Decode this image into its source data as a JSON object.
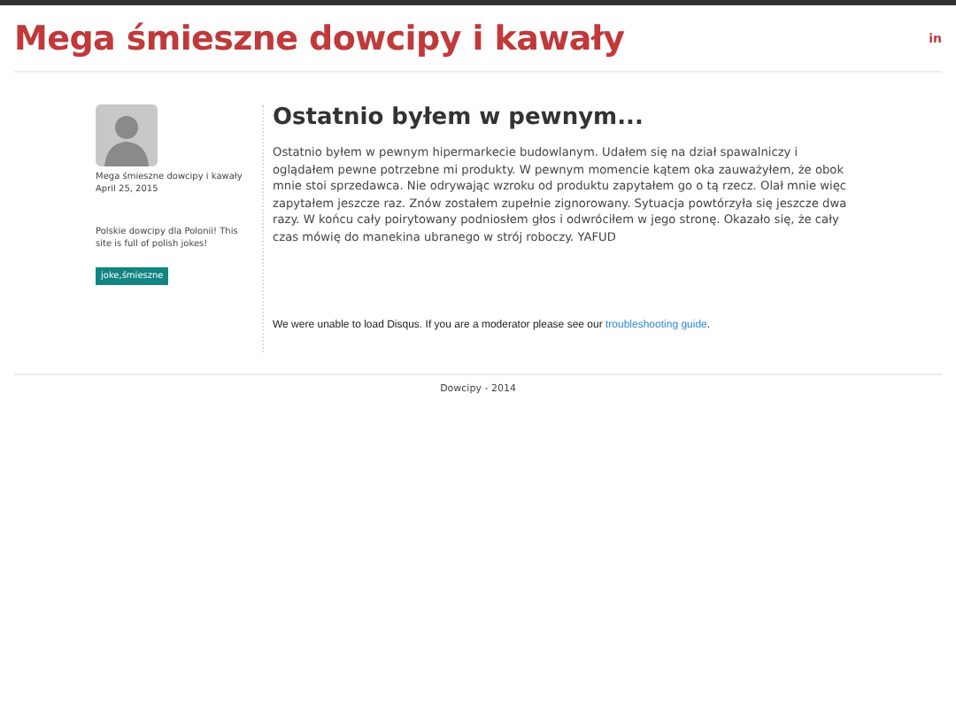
{
  "header": {
    "title": "Mega śmieszne dowcipy i kawały",
    "social_link": "in"
  },
  "sidebar": {
    "author": "Mega śmieszne dowcipy i kawały",
    "date": "April 25, 2015",
    "description": "Polskie dowcipy dla Polonii! This site is full of polish jokes!",
    "tags": [
      "joke,śmieszne"
    ]
  },
  "post": {
    "title": "Ostatnio byłem w pewnym...",
    "body": "Ostatnio byłem w pewnym hipermarkecie budowlanym. Udałem się na dział spawalniczy i oglądałem pewne potrzebne mi produkty. W pewnym momencie kątem oka zauważyłem, że obok mnie stoi sprzedawca. Nie odrywając wzroku od produktu zapytałem go o tą rzecz. Olał mnie więc zapytałem jeszcze raz. Znów zostałem zupełnie zignorowany. Sytuacja powtórzyła się jeszcze dwa razy. W końcu cały poirytowany podniosłem głos i odwróciłem w jego stronę. Okazało się, że cały czas mówię do manekina ubranego w strój roboczy. YAFUD"
  },
  "comments_notice": {
    "text": "We were unable to load Disqus. If you are a moderator please see our",
    "link": "troubleshooting guide",
    "end": "."
  },
  "footer": {
    "text": "Dowcipy - 2014"
  }
}
